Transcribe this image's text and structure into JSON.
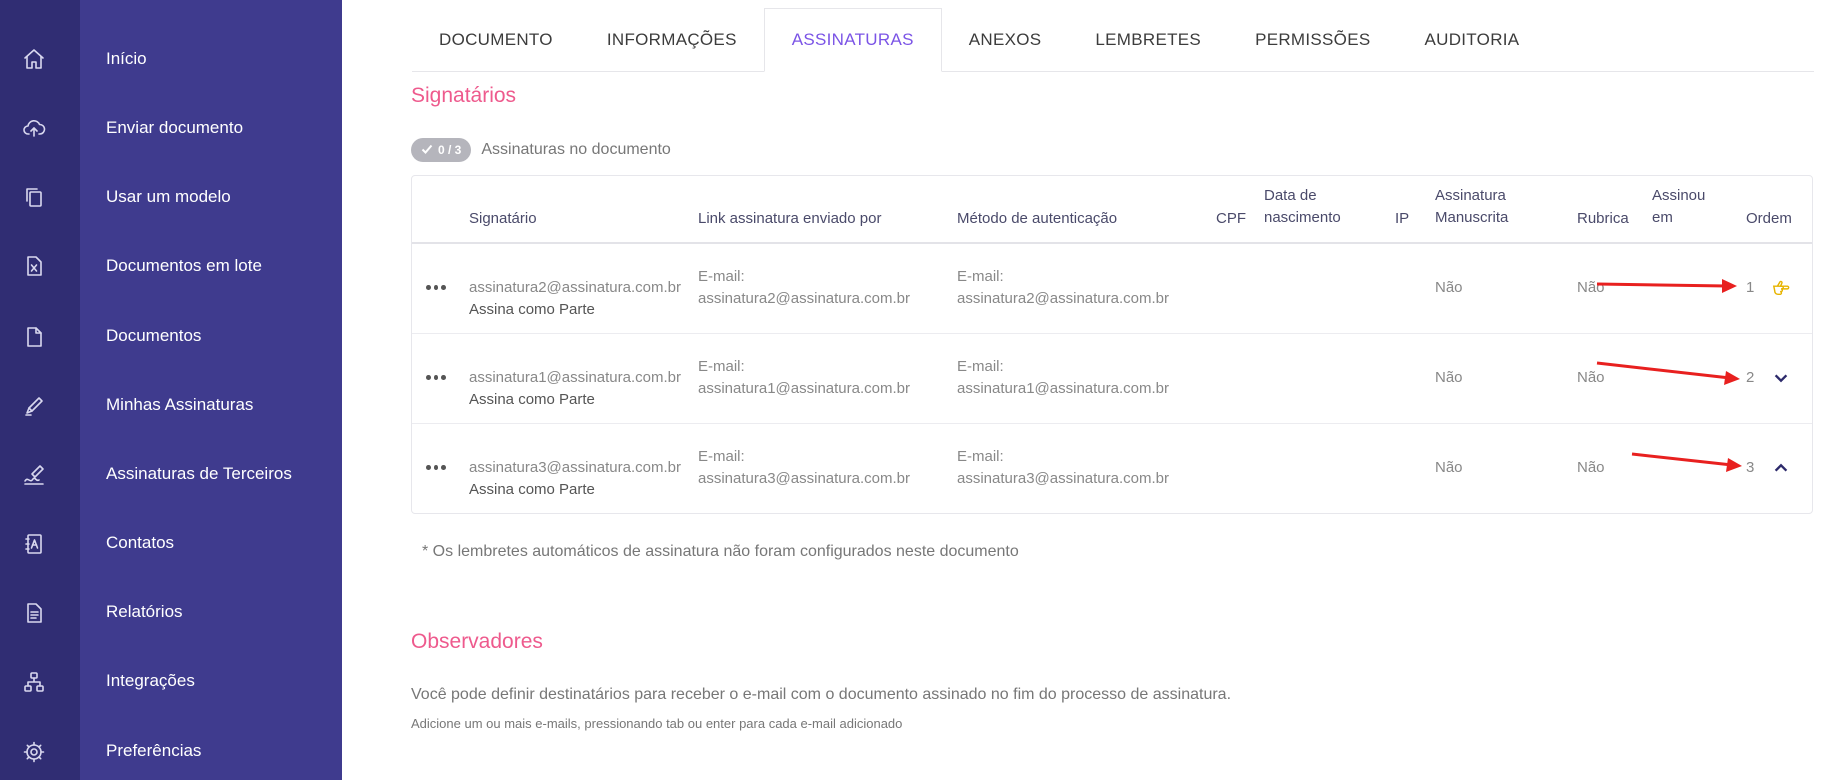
{
  "sidebar": {
    "items": [
      {
        "label": "Início",
        "icon": "home-icon"
      },
      {
        "label": "Enviar documento",
        "icon": "cloud-upload-icon"
      },
      {
        "label": "Usar um modelo",
        "icon": "template-icon"
      },
      {
        "label": "Documentos em lote",
        "icon": "excel-file-icon"
      },
      {
        "label": "Documentos",
        "icon": "document-icon"
      },
      {
        "label": "Minhas Assinaturas",
        "icon": "pen-icon"
      },
      {
        "label": "Assinaturas de Terceiros",
        "icon": "signature-icon"
      },
      {
        "label": "Contatos",
        "icon": "contacts-icon"
      },
      {
        "label": "Relatórios",
        "icon": "report-icon"
      },
      {
        "label": "Integrações",
        "icon": "integrations-icon"
      },
      {
        "label": "Preferências",
        "icon": "gear-icon"
      }
    ]
  },
  "tabs": [
    "DOCUMENTO",
    "INFORMAÇÕES",
    "ASSINATURAS",
    "ANEXOS",
    "LEMBRETES",
    "PERMISSÕES",
    "AUDITORIA"
  ],
  "active_tab": "ASSINATURAS",
  "signatarios": {
    "title": "Signatários",
    "badge": "0 / 3",
    "badge_label": "Assinaturas no documento"
  },
  "table": {
    "headers": {
      "signatario": "Signatário",
      "link": "Link assinatura enviado por",
      "metodo": "Método de autenticação",
      "cpf": "CPF",
      "nascimento_1": "Data de",
      "nascimento_2": "nascimento",
      "ip": "IP",
      "manuscrita_1": "Assinatura",
      "manuscrita_2": "Manuscrita",
      "rubrica": "Rubrica",
      "assinou_1": "Assinou",
      "assinou_2": "em",
      "ordem": "Ordem"
    },
    "rows": [
      {
        "email": "assinatura2@assinatura.com.br",
        "role": "Assina como Parte",
        "link_label": "E-mail:",
        "link_value": "assinatura2@assinatura.com.br",
        "metodo_label": "E-mail:",
        "metodo_value": "assinatura2@assinatura.com.br",
        "manuscrita": "Não",
        "rubrica": "Não",
        "ordem": "1",
        "order_icon": "hand-pointer-icon"
      },
      {
        "email": "assinatura1@assinatura.com.br",
        "role": "Assina como Parte",
        "link_label": "E-mail:",
        "link_value": "assinatura1@assinatura.com.br",
        "metodo_label": "E-mail:",
        "metodo_value": "assinatura1@assinatura.com.br",
        "manuscrita": "Não",
        "rubrica": "Não",
        "ordem": "2",
        "order_icon": "chevron-down-icon"
      },
      {
        "email": "assinatura3@assinatura.com.br",
        "role": "Assina como Parte",
        "link_label": "E-mail:",
        "link_value": "assinatura3@assinatura.com.br",
        "metodo_label": "E-mail:",
        "metodo_value": "assinatura3@assinatura.com.br",
        "manuscrita": "Não",
        "rubrica": "Não",
        "ordem": "3",
        "order_icon": "chevron-up-icon"
      }
    ]
  },
  "note": "* Os lembretes automáticos de assinatura não foram configurados neste documento",
  "observadores": {
    "title": "Observadores",
    "text": "Você pode definir destinatários para receber o e-mail com o documento assinado no fim do processo de assinatura.",
    "hint": "Adicione um ou mais e-mails, pressionando tab ou enter para cada e-mail adicionado"
  },
  "colors": {
    "rail": "#302d73",
    "nav": "#3f3b8e",
    "accent_pink": "#ee5a8d",
    "active_tab": "#7b54e6",
    "annotation_arrow": "#e8201f"
  }
}
